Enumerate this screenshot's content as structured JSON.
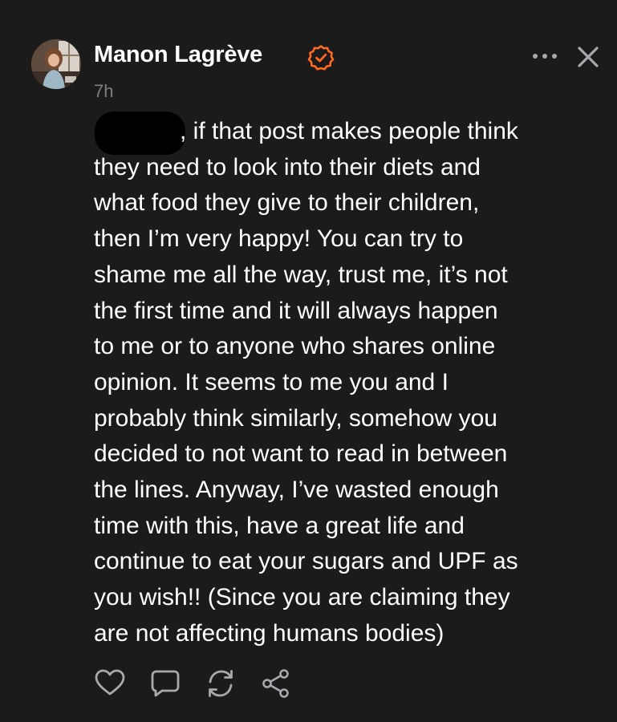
{
  "post": {
    "author": {
      "name": "Manon Lagrève",
      "verified_icon": "verified-check-icon",
      "badge_color": "#ff6a1f"
    },
    "timestamp": "7h",
    "body_lines": [
      ", if that post makes people think",
      "they need to look into their diets and",
      "what food they give to their children,",
      "then I’m very happy! You can try to",
      "shame me all the way, trust me, it’s not",
      "the first time and it will always happen",
      "to me or to anyone who shares online",
      "opinion. It seems to me you and I",
      "probably think similarly, somehow you",
      "decided to not want to read in between",
      "the lines. Anyway, I’ve wasted enough",
      "time with this, have a great life and",
      "continue to eat your sugars and UPF as",
      "you wish!! (Since you are claiming they",
      "are not affecting humans bodies)"
    ],
    "actions": [
      {
        "icon": "heart-icon"
      },
      {
        "icon": "comment-icon"
      },
      {
        "icon": "repost-icon"
      },
      {
        "icon": "share-icon"
      }
    ]
  },
  "header_controls": {
    "more_icon": "more-horizontal-icon",
    "close_icon": "close-icon"
  },
  "colors": {
    "background": "#1b1b1c",
    "text": "#ffffff",
    "muted": "#7e7e83",
    "icon": "#a9a9ad"
  }
}
